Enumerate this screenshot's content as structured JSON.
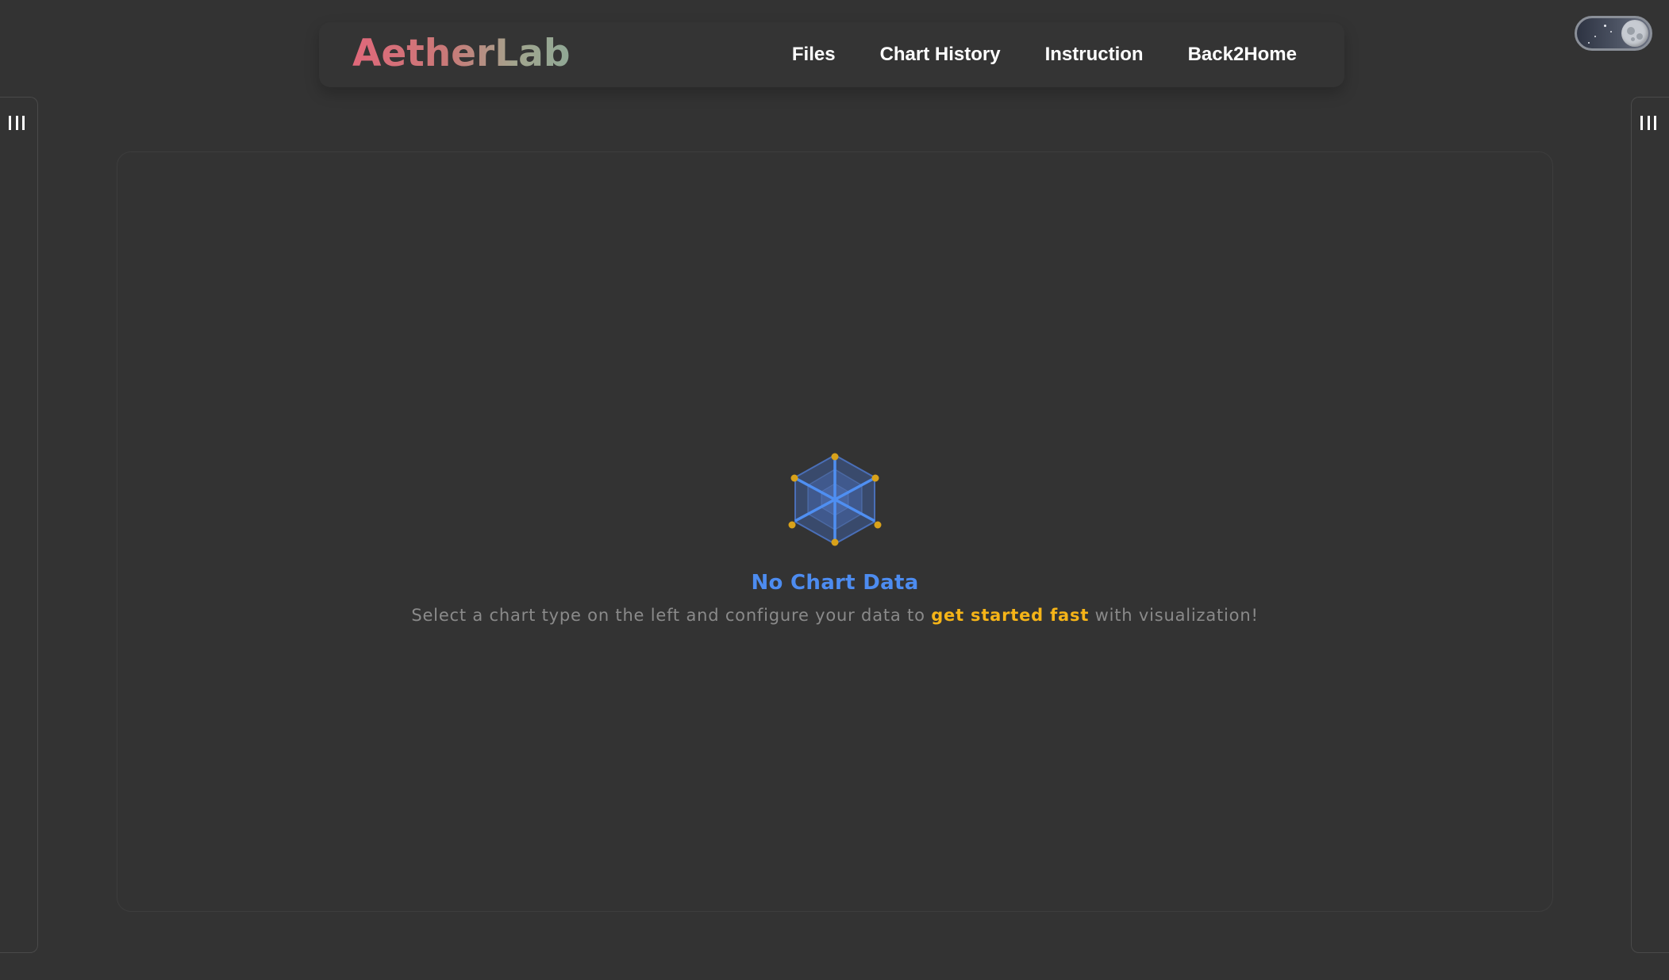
{
  "header": {
    "logo": "AetherLab",
    "nav": [
      {
        "label": "Files"
      },
      {
        "label": "Chart History"
      },
      {
        "label": "Instruction"
      },
      {
        "label": "Back2Home"
      }
    ]
  },
  "theme_toggle": {
    "icon": "moon-icon",
    "mode": "dark"
  },
  "left_panel": {
    "toggle_icon": "panel-bars-icon"
  },
  "right_panel": {
    "toggle_icon": "panel-bars-icon"
  },
  "empty_state": {
    "icon": "radar-chart-icon",
    "title": "No Chart Data",
    "description_before": "Select a chart type on the left and configure your data to ",
    "description_highlight": "get started fast",
    "description_after": " with visualization!"
  },
  "colors": {
    "background": "#333333",
    "accent_blue": "#4d8cf0",
    "highlight_yellow": "#f5b418",
    "muted_text": "#8a8a8a"
  }
}
